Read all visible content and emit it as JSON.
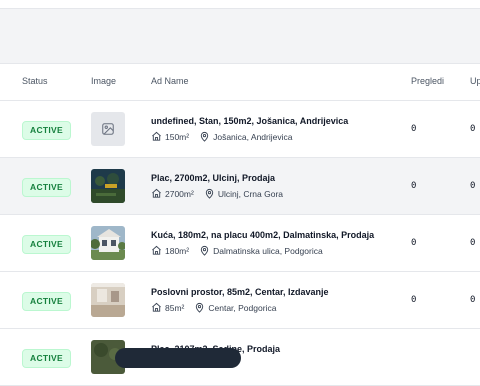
{
  "table": {
    "headers": {
      "status": "Status",
      "image": "Image",
      "ad_name": "Ad Name",
      "pregledi": "Pregledi",
      "up": "Up"
    },
    "rows": [
      {
        "status": "ACTIVE",
        "image": "placeholder-image-icon",
        "title": "undefined, Stan, 150m2, Jošanica, Andrijevica",
        "area": "150m²",
        "location": "Jošanica, Andrijevica",
        "pregledi": "0",
        "up": "0"
      },
      {
        "status": "ACTIVE",
        "image": "land-photo",
        "title": "Plac, 2700m2, Ulcinj, Prodaja",
        "area": "2700m²",
        "location": "Ulcinj, Crna Gora",
        "pregledi": "0",
        "up": "0"
      },
      {
        "status": "ACTIVE",
        "image": "house-photo",
        "title": "Kuća, 180m2, na placu 400m2, Dalmatinska, Prodaja",
        "area": "180m²",
        "location": "Dalmatinska ulica, Podgorica",
        "pregledi": "0",
        "up": "0"
      },
      {
        "status": "ACTIVE",
        "image": "office-photo",
        "title": "Poslovni prostor, 85m2, Centar, Izdavanje",
        "area": "85m²",
        "location": "Centar, Podgorica",
        "pregledi": "0",
        "up": "0"
      },
      {
        "status": "ACTIVE",
        "image": "land-photo",
        "title": "Plac, 2107m2, Sadine, Prodaja",
        "area": "",
        "location": "",
        "pregledi": "",
        "up": ""
      }
    ]
  },
  "colors": {
    "active_badge_bg": "#dcfce7",
    "active_badge_text": "#15803d"
  }
}
